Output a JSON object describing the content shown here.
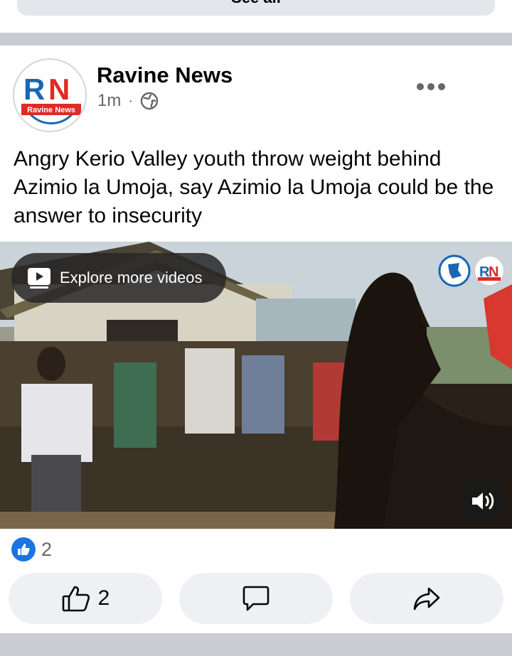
{
  "feed": {
    "see_all_label": "See all"
  },
  "post": {
    "author": "Ravine News",
    "time": "1m",
    "separator": "·",
    "privacy_icon": "globe-icon",
    "more_icon": "more-options-icon",
    "text": "Angry Kerio Valley youth throw weight behind Azimio la Umoja, say Azimio la Umoja could be the answer to insecurity",
    "avatar": {
      "logo_letters": "RN",
      "logo_caption": "Ravine News",
      "colors": {
        "r": "#1a66b5",
        "n": "#e02a26",
        "ring": "#d5d5d5"
      }
    },
    "video": {
      "explore_label": "Explore more videos",
      "sound_icon": "volume-icon",
      "watermark_letters": "RN"
    },
    "reactions": {
      "icon": "like-badge-icon",
      "count": "2"
    },
    "actions": {
      "like_count": "2",
      "like_icon": "thumbs-up-icon",
      "comment_icon": "comment-icon",
      "share_icon": "share-icon"
    }
  },
  "colors": {
    "accent": "#1b74e4",
    "divider": "#c9ccd1",
    "button_bg": "#eef0f3",
    "secondary_text": "#65676b"
  }
}
